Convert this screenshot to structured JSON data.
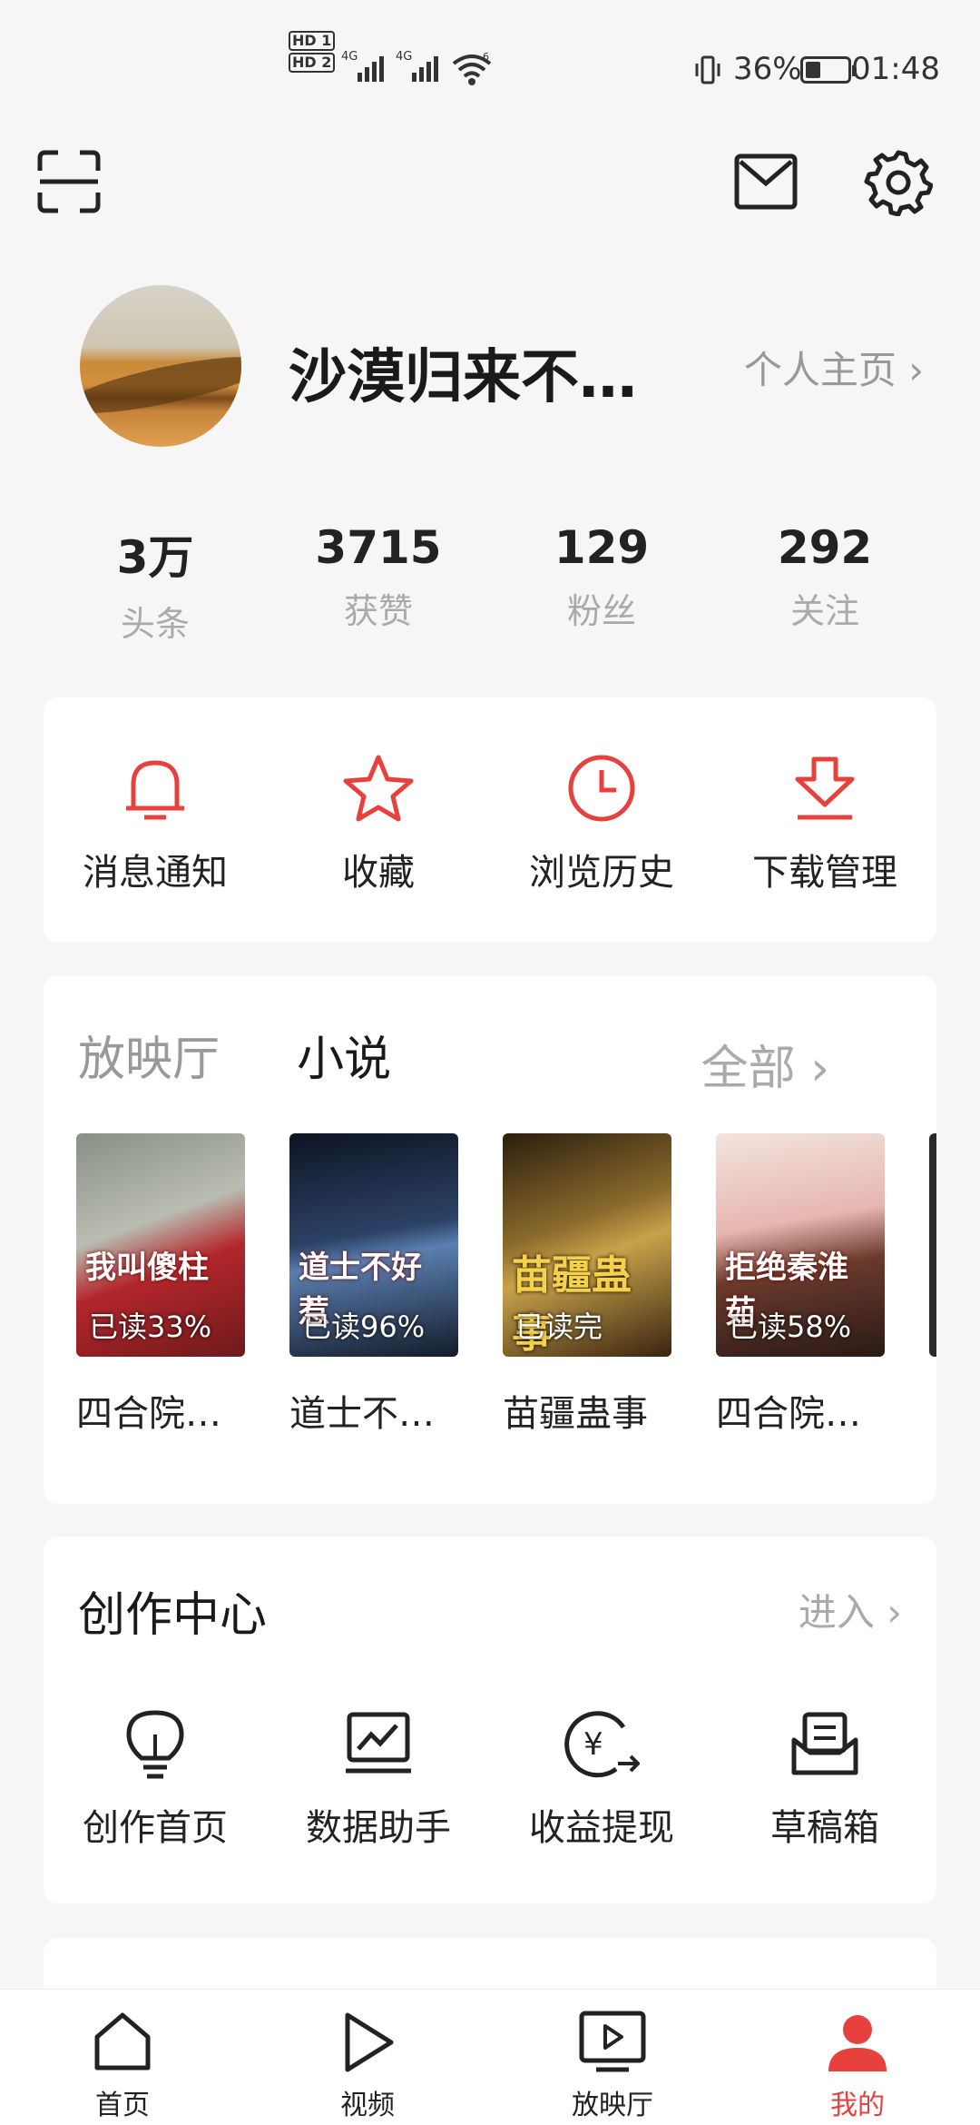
{
  "status_bar": {
    "time": "01:48",
    "battery_pct": "36%",
    "battery_level": 0.36,
    "hd1": "HD 1",
    "hd2": "HD 2",
    "net1": "4G",
    "net2": "4G",
    "wifi": "6"
  },
  "header": {
    "scan_icon": "scan-icon",
    "mail_icon": "mail-icon",
    "settings_icon": "gear-icon"
  },
  "profile": {
    "username": "沙漠归来不…",
    "homepage_label": "个人主页 ›"
  },
  "stats": [
    {
      "value": "3万",
      "label": "头条"
    },
    {
      "value": "3715",
      "label": "获赞"
    },
    {
      "value": "129",
      "label": "粉丝"
    },
    {
      "value": "292",
      "label": "关注"
    }
  ],
  "quick_actions": [
    {
      "label": "消息通知",
      "icon": "bell-icon"
    },
    {
      "label": "收藏",
      "icon": "star-icon"
    },
    {
      "label": "浏览历史",
      "icon": "clock-icon"
    },
    {
      "label": "下载管理",
      "icon": "download-icon"
    }
  ],
  "media": {
    "tabs": [
      "放映厅",
      "小说"
    ],
    "active_tab": "小说",
    "more_label": "全部 ›",
    "books": [
      {
        "cover_title": "我叫傻柱",
        "progress": "已读33%",
        "name": "四合院…",
        "color": "#b3262b"
      },
      {
        "cover_title": "道士不好惹",
        "progress": "已读96%",
        "name": "道士不…",
        "color": "#1e2a44"
      },
      {
        "cover_title": "苗疆蛊事",
        "progress": "已读完",
        "name": "苗疆蛊事",
        "color": "#6b4a1c"
      },
      {
        "cover_title": "拒绝秦淮茹",
        "progress": "已读58%",
        "name": "四合院…",
        "color": "#c94a55"
      }
    ]
  },
  "creator": {
    "title": "创作中心",
    "enter_label": "进入 ›",
    "items": [
      {
        "label": "创作首页",
        "icon": "lightbulb-icon"
      },
      {
        "label": "数据助手",
        "icon": "chart-icon"
      },
      {
        "label": "收益提现",
        "icon": "yuan-coin-icon"
      },
      {
        "label": "草稿箱",
        "icon": "draft-box-icon"
      }
    ]
  },
  "bottom_nav": [
    {
      "label": "首页",
      "icon": "home-icon"
    },
    {
      "label": "视频",
      "icon": "play-icon"
    },
    {
      "label": "放映厅",
      "icon": "tv-icon"
    },
    {
      "label": "我的",
      "icon": "user-icon"
    }
  ],
  "colors": {
    "accent": "#e8403c",
    "muted": "#999999",
    "background": "#f6f6f6"
  }
}
